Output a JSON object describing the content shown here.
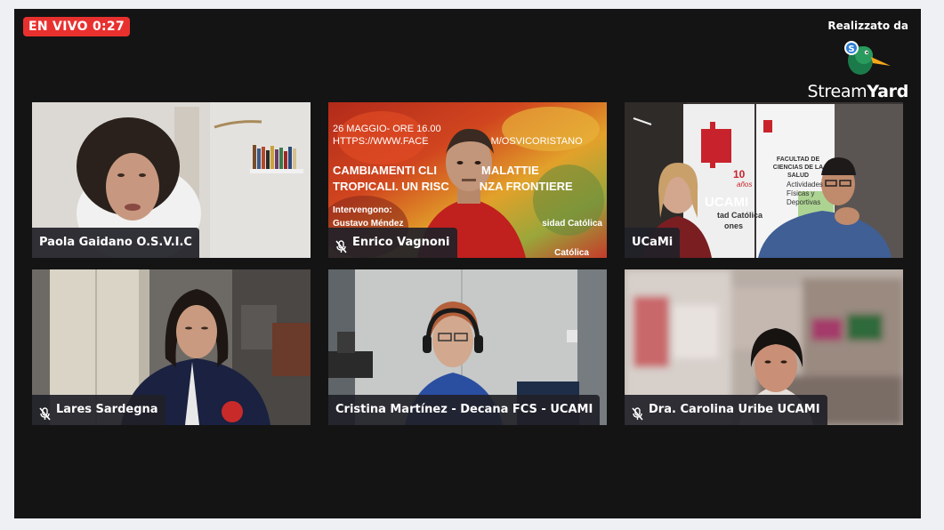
{
  "live": {
    "label": "EN VIVO 0:27"
  },
  "brand": {
    "caption": "Realizzato da",
    "name_light": "Stream",
    "name_bold": "Yard"
  },
  "participants": [
    {
      "name": "Paola Gaidano O.S.V.I.C",
      "muted": false
    },
    {
      "name": "Enrico Vagnoni",
      "muted": true
    },
    {
      "name": "UCaMi",
      "muted": false
    },
    {
      "name": "Lares Sardegna",
      "muted": true
    },
    {
      "name": "Cristina Martínez - Decana FCS - UCAMI",
      "muted": false
    },
    {
      "name": "Dra. Carolina Uribe UCAMI",
      "muted": true
    }
  ],
  "banner": {
    "date": "26 MAGGIO- ORE 16.00",
    "url_left": "HTTPS://WWW.FACE",
    "url_right": "M/OSVICORISTANO",
    "title_line1_a": "CAMBIAMENTI CLI",
    "title_line1_b": "MALATTIE",
    "title_line2_a": "TROPICALI. UN RISC",
    "title_line2_b": "NZA FRONTIERE",
    "speakers_label": "Intervengono:",
    "speaker": "Gustavo Méndez",
    "right_text1": "sidad Católica",
    "right_text2": "Católica"
  },
  "poster": {
    "ucami": "UCAMI",
    "anos_num": "10",
    "anos_label": "años",
    "line1": "tad Católica",
    "line2": "ones",
    "faculty": "FACULTAD DE CIENCIAS DE LA SALUD",
    "activities": "Actividades Físicas y Deportivas"
  },
  "colors": {
    "live": "#e8312f",
    "label_bg": "#212128",
    "stage": "#141414"
  }
}
